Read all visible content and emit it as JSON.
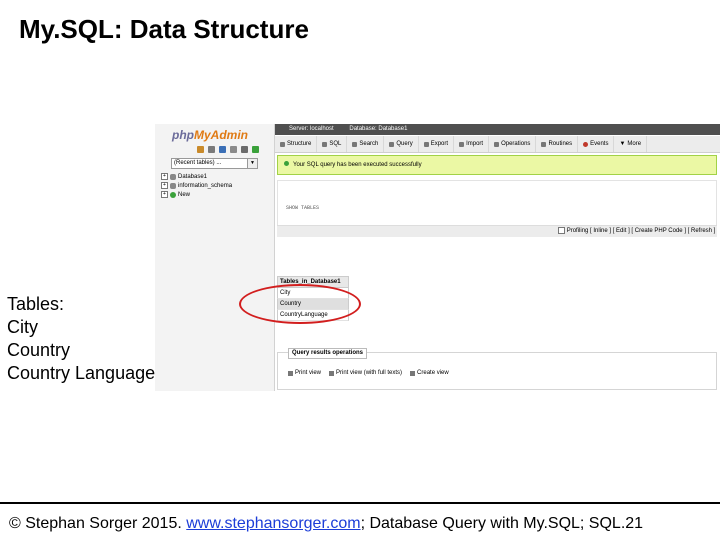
{
  "slide": {
    "title": "My.SQL: Data Structure",
    "caption": [
      "Tables:",
      "City",
      "Country",
      "Country Language"
    ],
    "footer": {
      "prefix": "© Stephan Sorger 2015. ",
      "link": "www.stephansorger.com",
      "suffix": "; Database Query with My.SQL;  SQL.21"
    },
    "highlight_color": "#d21e1e"
  },
  "pma": {
    "logo": {
      "part1": "php",
      "part2": "MyAdmin"
    },
    "nav_icons": [
      "home-icon",
      "exit-icon",
      "help-icon",
      "docs-icon",
      "settings-icon",
      "reload-icon"
    ],
    "recent_select": "(Recent tables) ...",
    "tree": [
      {
        "toggle": "+",
        "label": "Database1"
      },
      {
        "toggle": "+",
        "label": "information_schema"
      },
      {
        "toggle": "+",
        "label": "New"
      }
    ],
    "breadcrumb": {
      "server": "Server: localhost",
      "database": "Database: Database1"
    },
    "tabs": [
      {
        "icon": "structure-icon",
        "label": "Structure"
      },
      {
        "icon": "sql-icon",
        "label": "SQL"
      },
      {
        "icon": "search-icon",
        "label": "Search"
      },
      {
        "icon": "query-icon",
        "label": "Query"
      },
      {
        "icon": "export-icon",
        "label": "Export"
      },
      {
        "icon": "import-icon",
        "label": "Import"
      },
      {
        "icon": "operations-icon",
        "label": "Operations"
      },
      {
        "icon": "routines-icon",
        "label": "Routines"
      },
      {
        "icon": "events-icon",
        "label": "Events"
      },
      {
        "icon": "chevron-down-icon",
        "label": "More"
      }
    ],
    "success_message": "Your SQL query has been executed successfully",
    "query_text": "SHOW TABLES",
    "profiling_bar": "Profiling [ Inline ] [ Edit ] [ Create PHP Code ] [ Refresh ]",
    "results": {
      "header": "Tables_in_Database1",
      "rows": [
        "City",
        "Country",
        "CountryLanguage"
      ]
    },
    "query_results_ops": {
      "legend": "Query results operations",
      "links": [
        "Print view",
        "Print view (with full texts)",
        "Create view"
      ]
    }
  }
}
